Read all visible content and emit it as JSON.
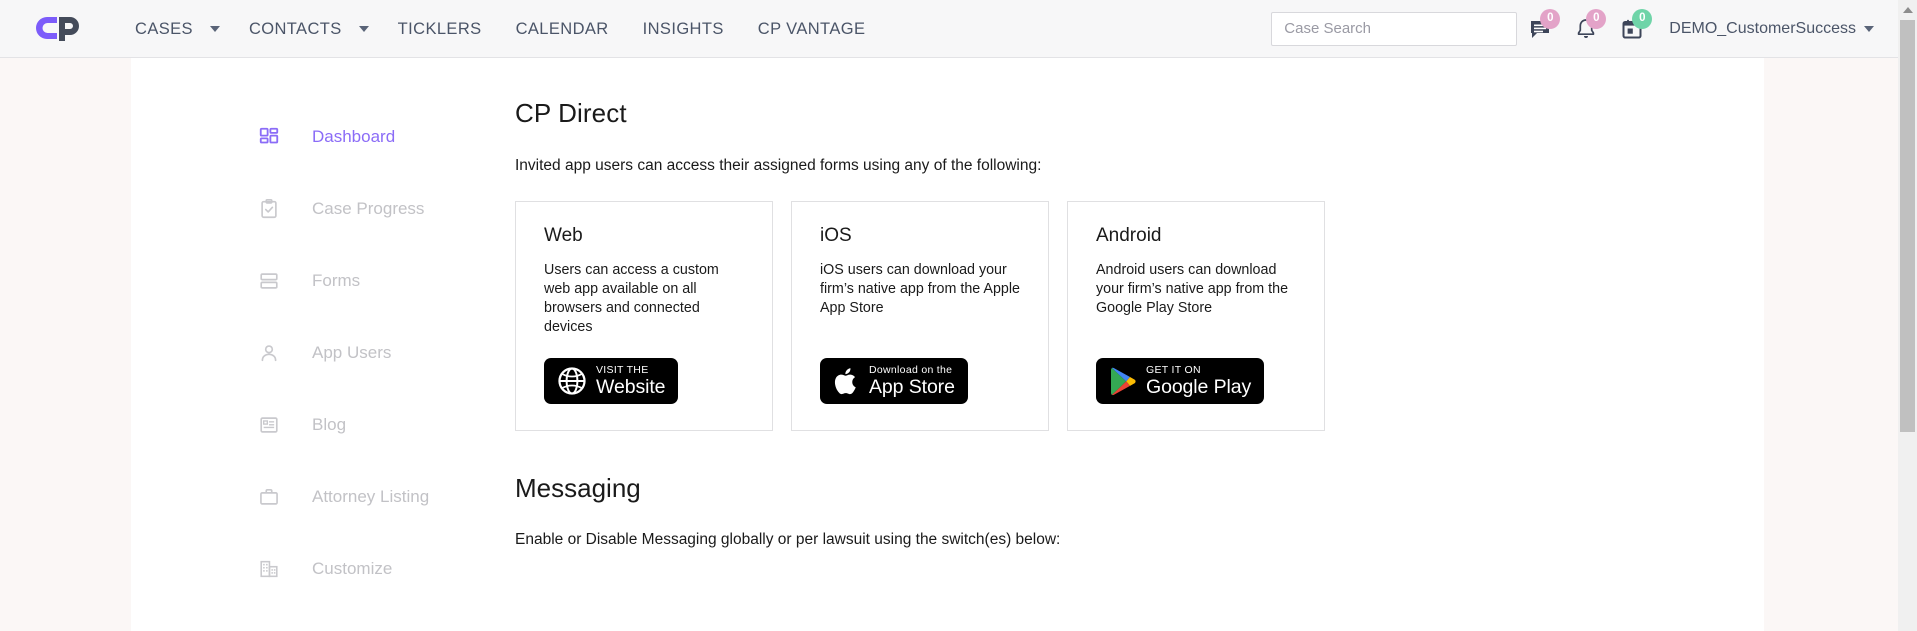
{
  "brand": {
    "logo_alt": "CP",
    "primary": "#7c5cfa",
    "dark": "#444b5a"
  },
  "topnav": {
    "items": [
      {
        "label": "CASES",
        "has_caret": true
      },
      {
        "label": "CONTACTS",
        "has_caret": true
      },
      {
        "label": "TICKLERS",
        "has_caret": false
      },
      {
        "label": "CALENDAR",
        "has_caret": false
      },
      {
        "label": "INSIGHTS",
        "has_caret": false
      },
      {
        "label": "CP VANTAGE",
        "has_caret": false
      }
    ],
    "search": {
      "placeholder": "Case Search",
      "value": ""
    },
    "icons": [
      {
        "name": "messages-icon",
        "badge": "0",
        "badge_color": "#e3a3c8"
      },
      {
        "name": "notifications-bell-icon",
        "badge": "0",
        "badge_color": "#e3a3c8"
      },
      {
        "name": "calendar-icon",
        "badge": "0",
        "badge_color": "#6fd4a8"
      }
    ],
    "user": {
      "name": "DEMO_CustomerSuccess"
    }
  },
  "sidebar": {
    "items": [
      {
        "label": "Dashboard",
        "icon": "dashboard-grid-icon",
        "active": true
      },
      {
        "label": "Case Progress",
        "icon": "clipboard-check-icon",
        "active": false
      },
      {
        "label": "Forms",
        "icon": "forms-rows-icon",
        "active": false
      },
      {
        "label": "App Users",
        "icon": "person-icon",
        "active": false
      },
      {
        "label": "Blog",
        "icon": "article-icon",
        "active": false
      },
      {
        "label": "Attorney Listing",
        "icon": "briefcase-icon",
        "active": false
      },
      {
        "label": "Customize",
        "icon": "building-icon",
        "active": false
      }
    ]
  },
  "main": {
    "cp_direct": {
      "title": "CP Direct",
      "intro": "Invited app users can access their assigned forms using any of the following:",
      "cards": [
        {
          "title": "Web",
          "description": "Users can access a custom web app available on all browsers and connected devices",
          "badge": {
            "icon": "globe-icon",
            "small_text": "VISIT THE",
            "big_text": "Website"
          }
        },
        {
          "title": "iOS",
          "description": "iOS users can download your firm’s native app from the Apple App Store",
          "badge": {
            "icon": "apple-logo-icon",
            "small_text": "Download on the",
            "big_text": "App Store"
          }
        },
        {
          "title": "Android",
          "description": "Android users can download your firm’s native app from the Google Play Store",
          "badge": {
            "icon": "google-play-icon",
            "small_text": "GET IT ON",
            "big_text": "Google Play"
          }
        }
      ]
    },
    "messaging": {
      "title": "Messaging",
      "intro": "Enable or Disable Messaging globally or per lawsuit using the switch(es) below:"
    }
  }
}
